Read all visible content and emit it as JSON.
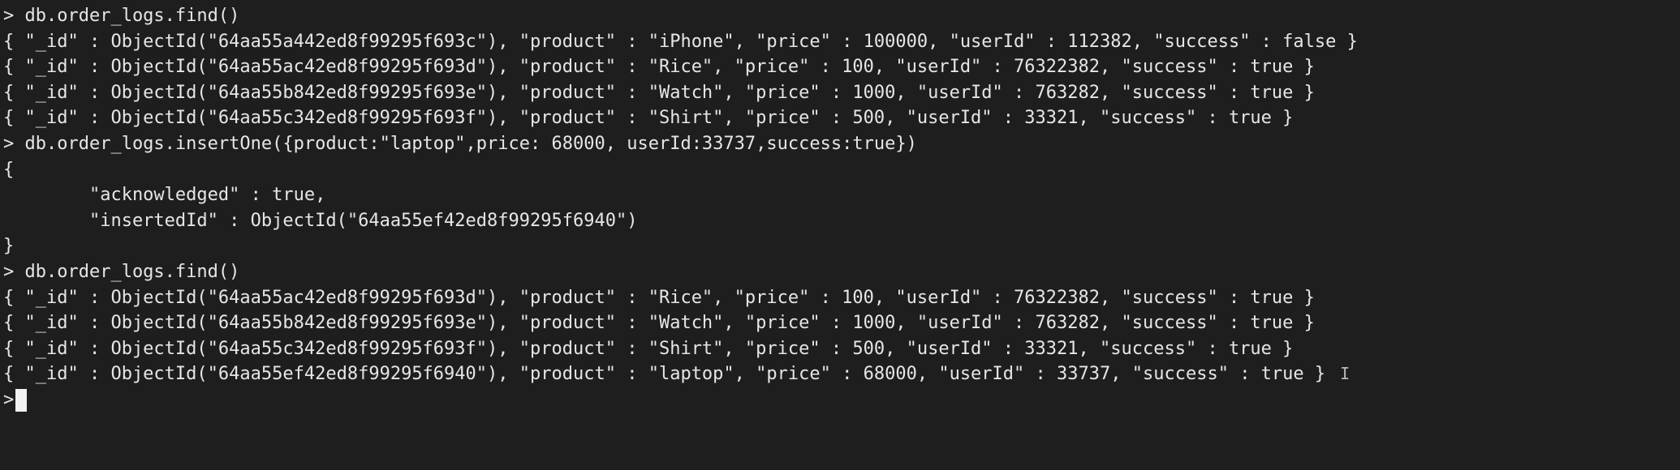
{
  "terminal": {
    "prompt_symbol": ">",
    "ibeam_glyph": "I",
    "lines": [
      "> db.order_logs.find()",
      "{ \"_id\" : ObjectId(\"64aa55a442ed8f99295f693c\"), \"product\" : \"iPhone\", \"price\" : 100000, \"userId\" : 112382, \"success\" : false }",
      "{ \"_id\" : ObjectId(\"64aa55ac42ed8f99295f693d\"), \"product\" : \"Rice\", \"price\" : 100, \"userId\" : 76322382, \"success\" : true }",
      "{ \"_id\" : ObjectId(\"64aa55b842ed8f99295f693e\"), \"product\" : \"Watch\", \"price\" : 1000, \"userId\" : 763282, \"success\" : true }",
      "{ \"_id\" : ObjectId(\"64aa55c342ed8f99295f693f\"), \"product\" : \"Shirt\", \"price\" : 500, \"userId\" : 33321, \"success\" : true }",
      "> db.order_logs.insertOne({product:\"laptop\",price: 68000, userId:33737,success:true})",
      "{",
      "        \"acknowledged\" : true,",
      "        \"insertedId\" : ObjectId(\"64aa55ef42ed8f99295f6940\")",
      "}",
      "> db.order_logs.find()",
      "{ \"_id\" : ObjectId(\"64aa55ac42ed8f99295f693d\"), \"product\" : \"Rice\", \"price\" : 100, \"userId\" : 76322382, \"success\" : true }",
      "{ \"_id\" : ObjectId(\"64aa55b842ed8f99295f693e\"), \"product\" : \"Watch\", \"price\" : 1000, \"userId\" : 763282, \"success\" : true }",
      "{ \"_id\" : ObjectId(\"64aa55c342ed8f99295f693f\"), \"product\" : \"Shirt\", \"price\" : 500, \"userId\" : 33321, \"success\" : true }",
      "{ \"_id\" : ObjectId(\"64aa55ef42ed8f99295f6940\"), \"product\" : \"laptop\", \"price\" : 68000, \"userId\" : 33737, \"success\" : true }"
    ]
  }
}
